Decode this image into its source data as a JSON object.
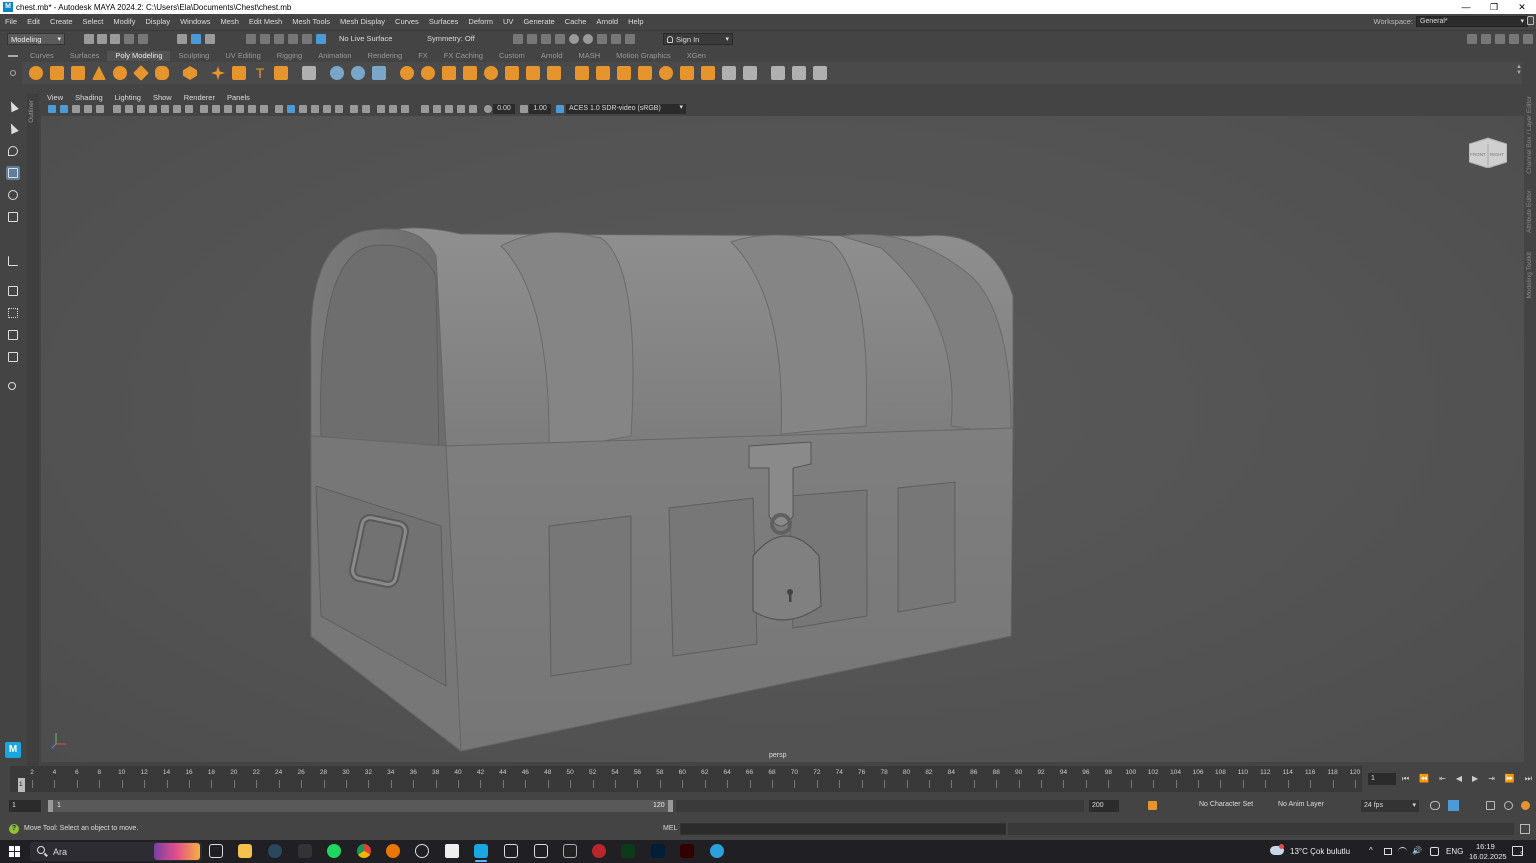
{
  "window": {
    "title": "chest.mb* - Autodesk MAYA 2024.2: C:\\Users\\Ela\\Documents\\Chest\\chest.mb",
    "minimize": "—",
    "restore": "❐",
    "close": "✕"
  },
  "menubar": {
    "items": [
      "File",
      "Edit",
      "Create",
      "Select",
      "Modify",
      "Display",
      "Windows",
      "Mesh",
      "Edit Mesh",
      "Mesh Tools",
      "Mesh Display",
      "Curves",
      "Surfaces",
      "Deform",
      "UV",
      "Generate",
      "Cache",
      "Arnold",
      "Help"
    ],
    "workspace_label": "Workspace:",
    "workspace_value": "General*"
  },
  "statusline": {
    "mode": "Modeling",
    "live_surface": "No Live Surface",
    "symmetry": "Symmetry: Off",
    "sign_in": "Sign In"
  },
  "shelf": {
    "tabs": [
      "Curves",
      "Surfaces",
      "Poly Modeling",
      "Sculpting",
      "UV Editing",
      "Rigging",
      "Animation",
      "Rendering",
      "FX",
      "FX Caching",
      "Custom",
      "Arnold",
      "MASH",
      "Motion Graphics",
      "XGen"
    ],
    "active_tab": "Poly Modeling"
  },
  "viewport": {
    "panel_menus": [
      "View",
      "Shading",
      "Lighting",
      "Show",
      "Renderer",
      "Panels"
    ],
    "exposure": "0.00",
    "gamma": "1.00",
    "color_space": "ACES 1.0 SDR-video (sRGB)",
    "camera_label": "persp",
    "viewcube_front": "FRONT",
    "viewcube_right": "RIGHT"
  },
  "side_panels": {
    "outliner": "Outliner",
    "channel_box": "Channel Box / Layer Editor",
    "attribute_editor": "Attribute Editor",
    "modeling_toolkit": "Modeling Toolkit"
  },
  "timeline": {
    "ticks": [
      "2",
      "4",
      "6",
      "8",
      "10",
      "12",
      "14",
      "16",
      "18",
      "20",
      "22",
      "24",
      "26",
      "28",
      "30",
      "32",
      "34",
      "36",
      "38",
      "40",
      "42",
      "44",
      "46",
      "48",
      "50",
      "52",
      "54",
      "56",
      "58",
      "60",
      "62",
      "64",
      "66",
      "68",
      "70",
      "72",
      "74",
      "76",
      "78",
      "80",
      "82",
      "84",
      "86",
      "88",
      "90",
      "92",
      "94",
      "96",
      "98",
      "100",
      "102",
      "104",
      "106",
      "108",
      "110",
      "112",
      "114",
      "116",
      "118",
      "120"
    ],
    "current_frame": "1",
    "frame_field": "1"
  },
  "range": {
    "start_field": "1",
    "range_start": "1",
    "range_end": "120",
    "end_field": "200",
    "character_set": "No Character Set",
    "anim_layer": "No Anim Layer",
    "fps": "24 fps"
  },
  "helpline": {
    "text": "Move Tool: Select an object to move.",
    "mel_label": "MEL"
  },
  "taskbar": {
    "search_text": "Ara",
    "weather": "13°C  Çok bulutlu",
    "language": "ENG",
    "time": "16:19",
    "date": "16.02.2025",
    "notification_count": "3"
  },
  "colors": {
    "maya_blue": "#1aa7e0",
    "shelf_orange": "#e6952e",
    "selection_blue": "#4c9ad6"
  }
}
